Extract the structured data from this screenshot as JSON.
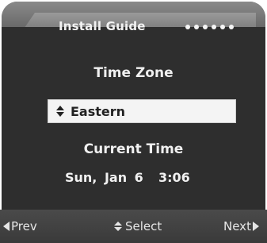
{
  "header": {
    "title": "Install Guide",
    "progress_steps_total": 6
  },
  "main": {
    "timezone_label": "Time Zone",
    "timezone_value": "Eastern",
    "current_time_label": "Current Time",
    "current_time_value": "Sun, Jan 6  3:06"
  },
  "footer": {
    "prev_label": "Prev",
    "select_label": "Select",
    "next_label": "Next"
  },
  "icons": {
    "select_arrows": "up-down-arrows-icon",
    "prev_arrow": "left-triangle-icon",
    "next_arrow": "right-triangle-icon"
  }
}
